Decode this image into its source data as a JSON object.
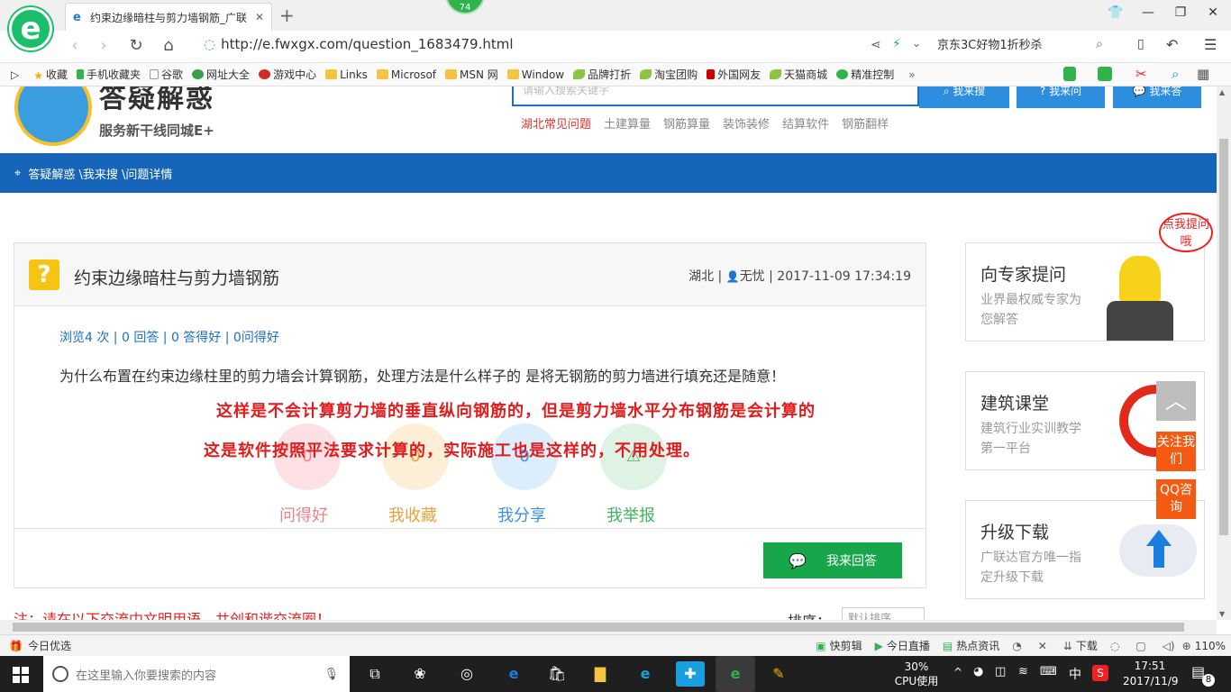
{
  "browser": {
    "tab_title": "约束边缘暗柱与剪力墙钢筋_广联",
    "tab_icon": "ie-icon",
    "badge": "74",
    "url": "http://e.fwxgx.com/question_1683479.html",
    "search_text": "京东3C好物1折秒杀"
  },
  "bookmarks": [
    {
      "label": "收藏",
      "icon": "star-icon"
    },
    {
      "label": "手机收藏夹",
      "icon": "phone-icon"
    },
    {
      "label": "谷歌",
      "icon": "page-icon"
    },
    {
      "label": "网址大全",
      "icon": "globe-icon"
    },
    {
      "label": "游戏中心",
      "icon": "game-icon"
    },
    {
      "label": "Links",
      "icon": "folder-icon"
    },
    {
      "label": "Microsof",
      "icon": "folder-icon"
    },
    {
      "label": "MSN 网",
      "icon": "folder-icon"
    },
    {
      "label": "Window",
      "icon": "folder-icon"
    },
    {
      "label": "品牌打折",
      "icon": "leaf-icon"
    },
    {
      "label": "淘宝团购",
      "icon": "leaf-icon"
    },
    {
      "label": "外国网友",
      "icon": "page-icon"
    },
    {
      "label": "天猫商城",
      "icon": "leaf-icon"
    },
    {
      "label": "精准控制",
      "icon": "wechat-icon"
    }
  ],
  "site": {
    "logo_title": "答疑解惑",
    "logo_subtitle": "服务新干线同城E+",
    "search_placeholder": "请输入搜索关键字",
    "search_buttons": [
      "我来搜",
      "我来问",
      "我来答"
    ],
    "quick_links": [
      "湖北常见问题",
      "土建算量",
      "钢筋算量",
      "装饰装修",
      "结算软件",
      "钢筋翻样"
    ],
    "breadcrumb": "答疑解惑 \\我来搜 \\问题详情"
  },
  "question": {
    "title": "约束边缘暗柱与剪力墙钢筋",
    "meta_region": "湖北 |",
    "meta_user": "无忧",
    "meta_time": "| 2017-11-09 17:34:19",
    "stats": "浏览4 次 | 0 回答 | 0 答得好 | 0问得好",
    "body": "为什么布置在约束边缘柱里的剪力墙会计算钢筋，处理方法是什么样子的  是将无钢筋的剪力墙进行填充还是随意！",
    "overlay_line1": "这样是不会计算剪力墙的垂直纵向钢筋的，但是剪力墙水平分布钢筋是会计算的",
    "overlay_line2": "这是软件按照平法要求计算的，实际施工也是这样的，不用处理。",
    "actions": [
      {
        "count": "0",
        "label": "问得好",
        "color": "#f07f8c"
      },
      {
        "count": "0",
        "label": "我收藏",
        "color": "#e6a23c"
      },
      {
        "count": "0",
        "label": "我分享",
        "color": "#3d8fe0"
      },
      {
        "count": "",
        "label": "我举报",
        "color": "#3eb55c"
      }
    ],
    "answer_button": "我来回答",
    "notice": "注：请在以下交流中文明用语，共创和谐交流圈！",
    "sort_label": "排序：",
    "sort_value": "默认排序"
  },
  "sidebar": {
    "bubble": "点我提问哦",
    "cards": [
      {
        "title": "向专家提问",
        "desc": "业界最权威专家为您解答"
      },
      {
        "title": "建筑课堂",
        "desc": "建筑行业实训教学第一平台"
      },
      {
        "title": "升级下载",
        "desc": "广联达官方唯一指定升级下载"
      }
    ],
    "float_follow": "关注我们",
    "float_qq": "QQ咨询"
  },
  "statusbar": {
    "left": "今日优选",
    "items": [
      "快剪辑",
      "今日直播",
      "热点资讯",
      "下载"
    ],
    "zoom": "110%"
  },
  "taskbar": {
    "search_placeholder": "在这里输入你要搜索的内容",
    "cpu_value": "30%",
    "cpu_label": "CPU使用",
    "ime": "中",
    "time": "17:51",
    "date": "2017/11/9",
    "notification_count": "8"
  },
  "colors": {
    "brand_blue": "#1765b9",
    "answer_green": "#17a74a",
    "accent_red": "#e21c1c",
    "float_orange": "#f55a12"
  }
}
